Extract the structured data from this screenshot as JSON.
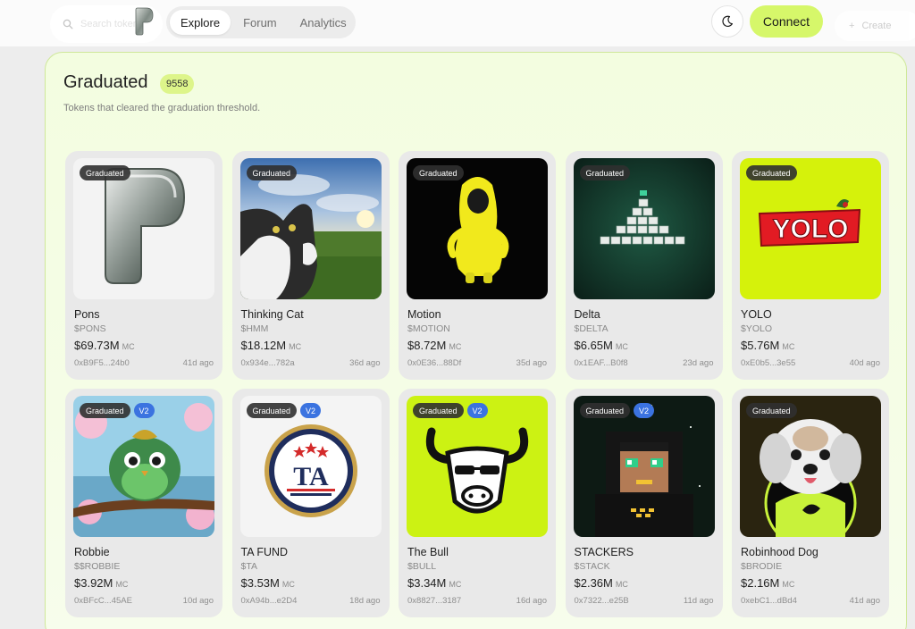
{
  "header": {
    "search_placeholder": "Search tokens",
    "nav_tabs": [
      {
        "label": "Explore",
        "active": true
      },
      {
        "label": "Forum",
        "active": false
      },
      {
        "label": "Analytics",
        "active": false
      }
    ],
    "theme_icon": "moon-icon",
    "connect_label": "Connect",
    "create_label": "Create"
  },
  "section": {
    "title": "Graduated",
    "count": "9558",
    "subtitle": "Tokens that cleared the graduation threshold."
  },
  "colors": {
    "accent": "#d6f76a",
    "v2_badge": "#3b73e0",
    "graduated_badge": "#303030"
  },
  "tokens": [
    {
      "name": "Pons",
      "symbol": "$PONS",
      "market_cap": "$69.73M",
      "mc_label": "MC",
      "address": "0xB9F5...24b0",
      "age": "41d ago",
      "badge": "Graduated",
      "v2": ""
    },
    {
      "name": "Thinking Cat",
      "symbol": "$HMM",
      "market_cap": "$18.12M",
      "mc_label": "MC",
      "address": "0x934e...782a",
      "age": "36d ago",
      "badge": "Graduated",
      "v2": ""
    },
    {
      "name": "Motion",
      "symbol": "$MOTION",
      "market_cap": "$8.72M",
      "mc_label": "MC",
      "address": "0x0E36...88Df",
      "age": "35d ago",
      "badge": "Graduated",
      "v2": ""
    },
    {
      "name": "Delta",
      "symbol": "$DELTA",
      "market_cap": "$6.65M",
      "mc_label": "MC",
      "address": "0x1EAF...B0f8",
      "age": "23d ago",
      "badge": "Graduated",
      "v2": ""
    },
    {
      "name": "YOLO",
      "symbol": "$YOLO",
      "market_cap": "$5.76M",
      "mc_label": "MC",
      "address": "0xE0b5...3e55",
      "age": "40d ago",
      "badge": "Graduated",
      "v2": ""
    },
    {
      "name": "Robbie",
      "symbol": "$$ROBBIE",
      "market_cap": "$3.92M",
      "mc_label": "MC",
      "address": "0xBFcC...45AE",
      "age": "10d ago",
      "badge": "Graduated",
      "v2": "V2"
    },
    {
      "name": "TA FUND",
      "symbol": "$TA",
      "market_cap": "$3.53M",
      "mc_label": "MC",
      "address": "0xA94b...e2D4",
      "age": "18d ago",
      "badge": "Graduated",
      "v2": "V2"
    },
    {
      "name": "The Bull",
      "symbol": "$BULL",
      "market_cap": "$3.34M",
      "mc_label": "MC",
      "address": "0x8827...3187",
      "age": "16d ago",
      "badge": "Graduated",
      "v2": "V2"
    },
    {
      "name": "STACKERS",
      "symbol": "$STACK",
      "market_cap": "$2.36M",
      "mc_label": "MC",
      "address": "0x7322...e25B",
      "age": "11d ago",
      "badge": "Graduated",
      "v2": "V2"
    },
    {
      "name": "Robinhood Dog",
      "symbol": "$BRODIE",
      "market_cap": "$2.16M",
      "mc_label": "MC",
      "address": "0xebC1...dBd4",
      "age": "41d ago",
      "badge": "Graduated",
      "v2": ""
    }
  ],
  "thumb_texts": {
    "yolo": "YOLO",
    "ta": "TA"
  }
}
